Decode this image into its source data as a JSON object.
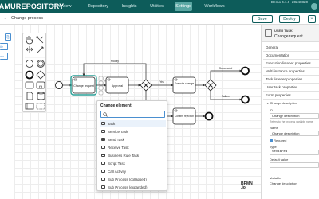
{
  "app": {
    "logo": "CAMUREPOSITORY",
    "user": "Demo 4.1.0 -20240820"
  },
  "nav": [
    "Overview",
    "Repository",
    "Insights",
    "Utilities",
    "Settings",
    "Workflows"
  ],
  "subbar": {
    "back": "←",
    "title": "Change process",
    "save": "Save",
    "deploy": "Deploy",
    "close": "×"
  },
  "left_buttons": [
    "⎘",
    "ile",
    "olc"
  ],
  "diagram": {
    "tasks": [
      "Change request",
      "Approval",
      "Execute change",
      "Confirm rejection"
    ],
    "flows": [
      "Modify",
      "Yes",
      "No",
      "Successful",
      "Failure"
    ]
  },
  "panel": {
    "type": "USER TASK",
    "name": "Change request",
    "sections": [
      "General",
      "Documentation",
      "Execution listener properties",
      "Multi instance properties",
      "Task listener properties",
      "User task properties",
      "Form properties"
    ],
    "form_field": "Change description",
    "id_label": "ID",
    "id_value": "Change description",
    "id_hint": "Refers to the process variable name",
    "name_label": "Name",
    "name_value": "Change description",
    "required_label": "Required",
    "type_label": "Type",
    "type_value": "textarea",
    "default_label": "Default value",
    "variable_label": "Variable",
    "variable_value": "Change description"
  },
  "menu": {
    "title": "Change element",
    "search_icon": "search-icon",
    "items": [
      "Task",
      "Service Task",
      "Send Task",
      "Receive Task",
      "Business Rule Task",
      "Script Task",
      "Call Activity",
      "Sub Process (collapsed)",
      "Sub Process (expanded)"
    ]
  },
  "watermark": {
    "line1": "BPMN",
    "line2": ".io"
  },
  "colors": {
    "brand": "#0d5c5a",
    "accent": "#4a8fd0",
    "selected": "#2aa198"
  }
}
